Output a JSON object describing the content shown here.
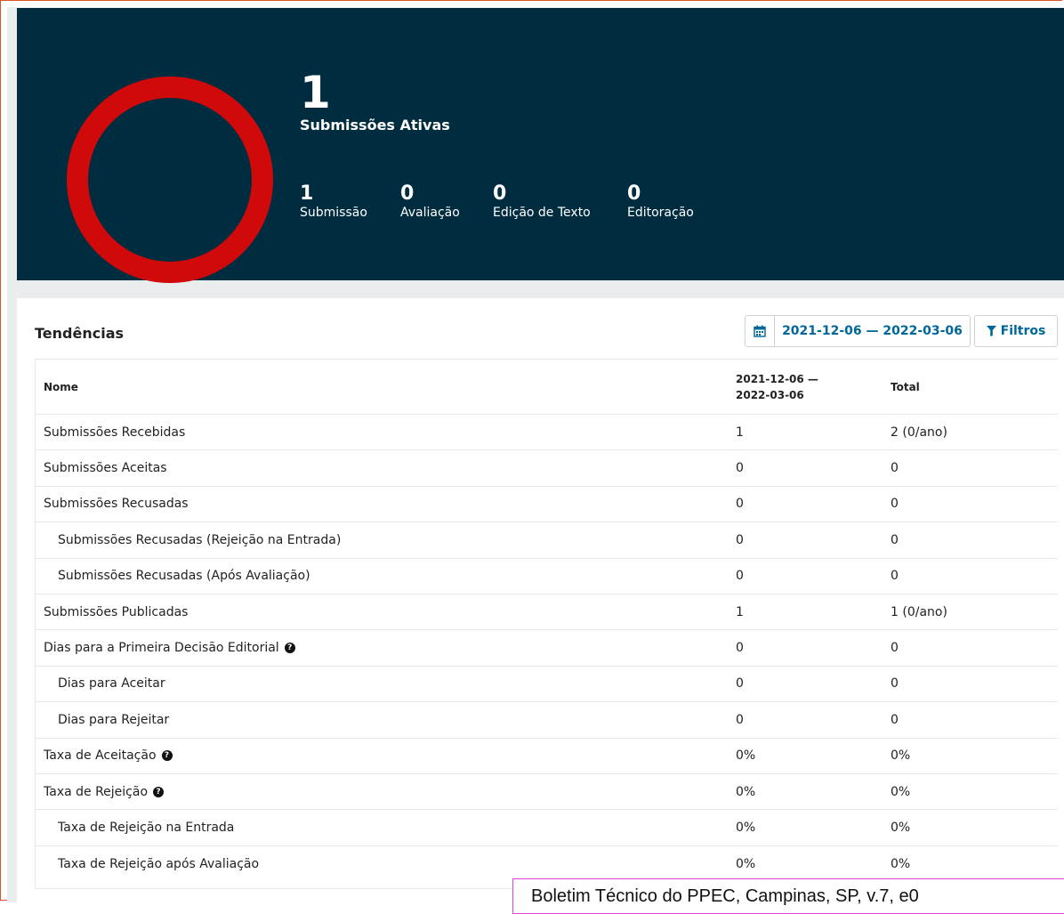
{
  "summary": {
    "active_count": "1",
    "active_label": "Submissões Ativas",
    "ring_color": "#d00a0a",
    "stages": [
      {
        "count": "1",
        "label": "Submissão"
      },
      {
        "count": "0",
        "label": "Avaliação"
      },
      {
        "count": "0",
        "label": "Edição de Texto"
      },
      {
        "count": "0",
        "label": "Editoração"
      }
    ]
  },
  "trends": {
    "title": "Tendências",
    "calendar_icon": "calendar-icon",
    "date_range": "2021-12-06 — 2022-03-06",
    "filter_label": "Filtros",
    "filter_icon": "filter-icon",
    "columns": [
      "Nome",
      "2021-12-06 —",
      "2022-03-06",
      "Total"
    ],
    "rows": [
      {
        "name": "Submissões Recebidas",
        "period": "1",
        "total": "2 (0/ano)"
      },
      {
        "name": "Submissões Aceitas",
        "period": "0",
        "total": "0"
      },
      {
        "name": "Submissões Recusadas",
        "period": "0",
        "total": "0"
      },
      {
        "name": "Submissões Recusadas (Rejeição na Entrada)",
        "period": "0",
        "total": "0"
      },
      {
        "name": "Submissões Recusadas (Após Avaliação)",
        "period": "0",
        "total": "0"
      },
      {
        "name": "Submissões Publicadas",
        "period": "1",
        "total": "1 (0/ano)"
      },
      {
        "name": "Dias para a Primeira Decisão Editorial",
        "period": "0",
        "total": "0"
      },
      {
        "name": "Dias para Aceitar",
        "period": "0",
        "total": "0"
      },
      {
        "name": "Dias para Rejeitar",
        "period": "0",
        "total": "0"
      },
      {
        "name": "Taxa de Aceitação",
        "period": "0%",
        "total": "0%"
      },
      {
        "name": "Taxa de Rejeição",
        "period": "0%",
        "total": "0%"
      },
      {
        "name": "Taxa de Rejeição na Entrada",
        "period": "0%",
        "total": "0%"
      },
      {
        "name": "Taxa de Rejeição após Avaliação",
        "period": "0%",
        "total": "0%"
      }
    ]
  },
  "footer_note": "Boletim Técnico do PPEC, Campinas, SP, v.7, e0"
}
